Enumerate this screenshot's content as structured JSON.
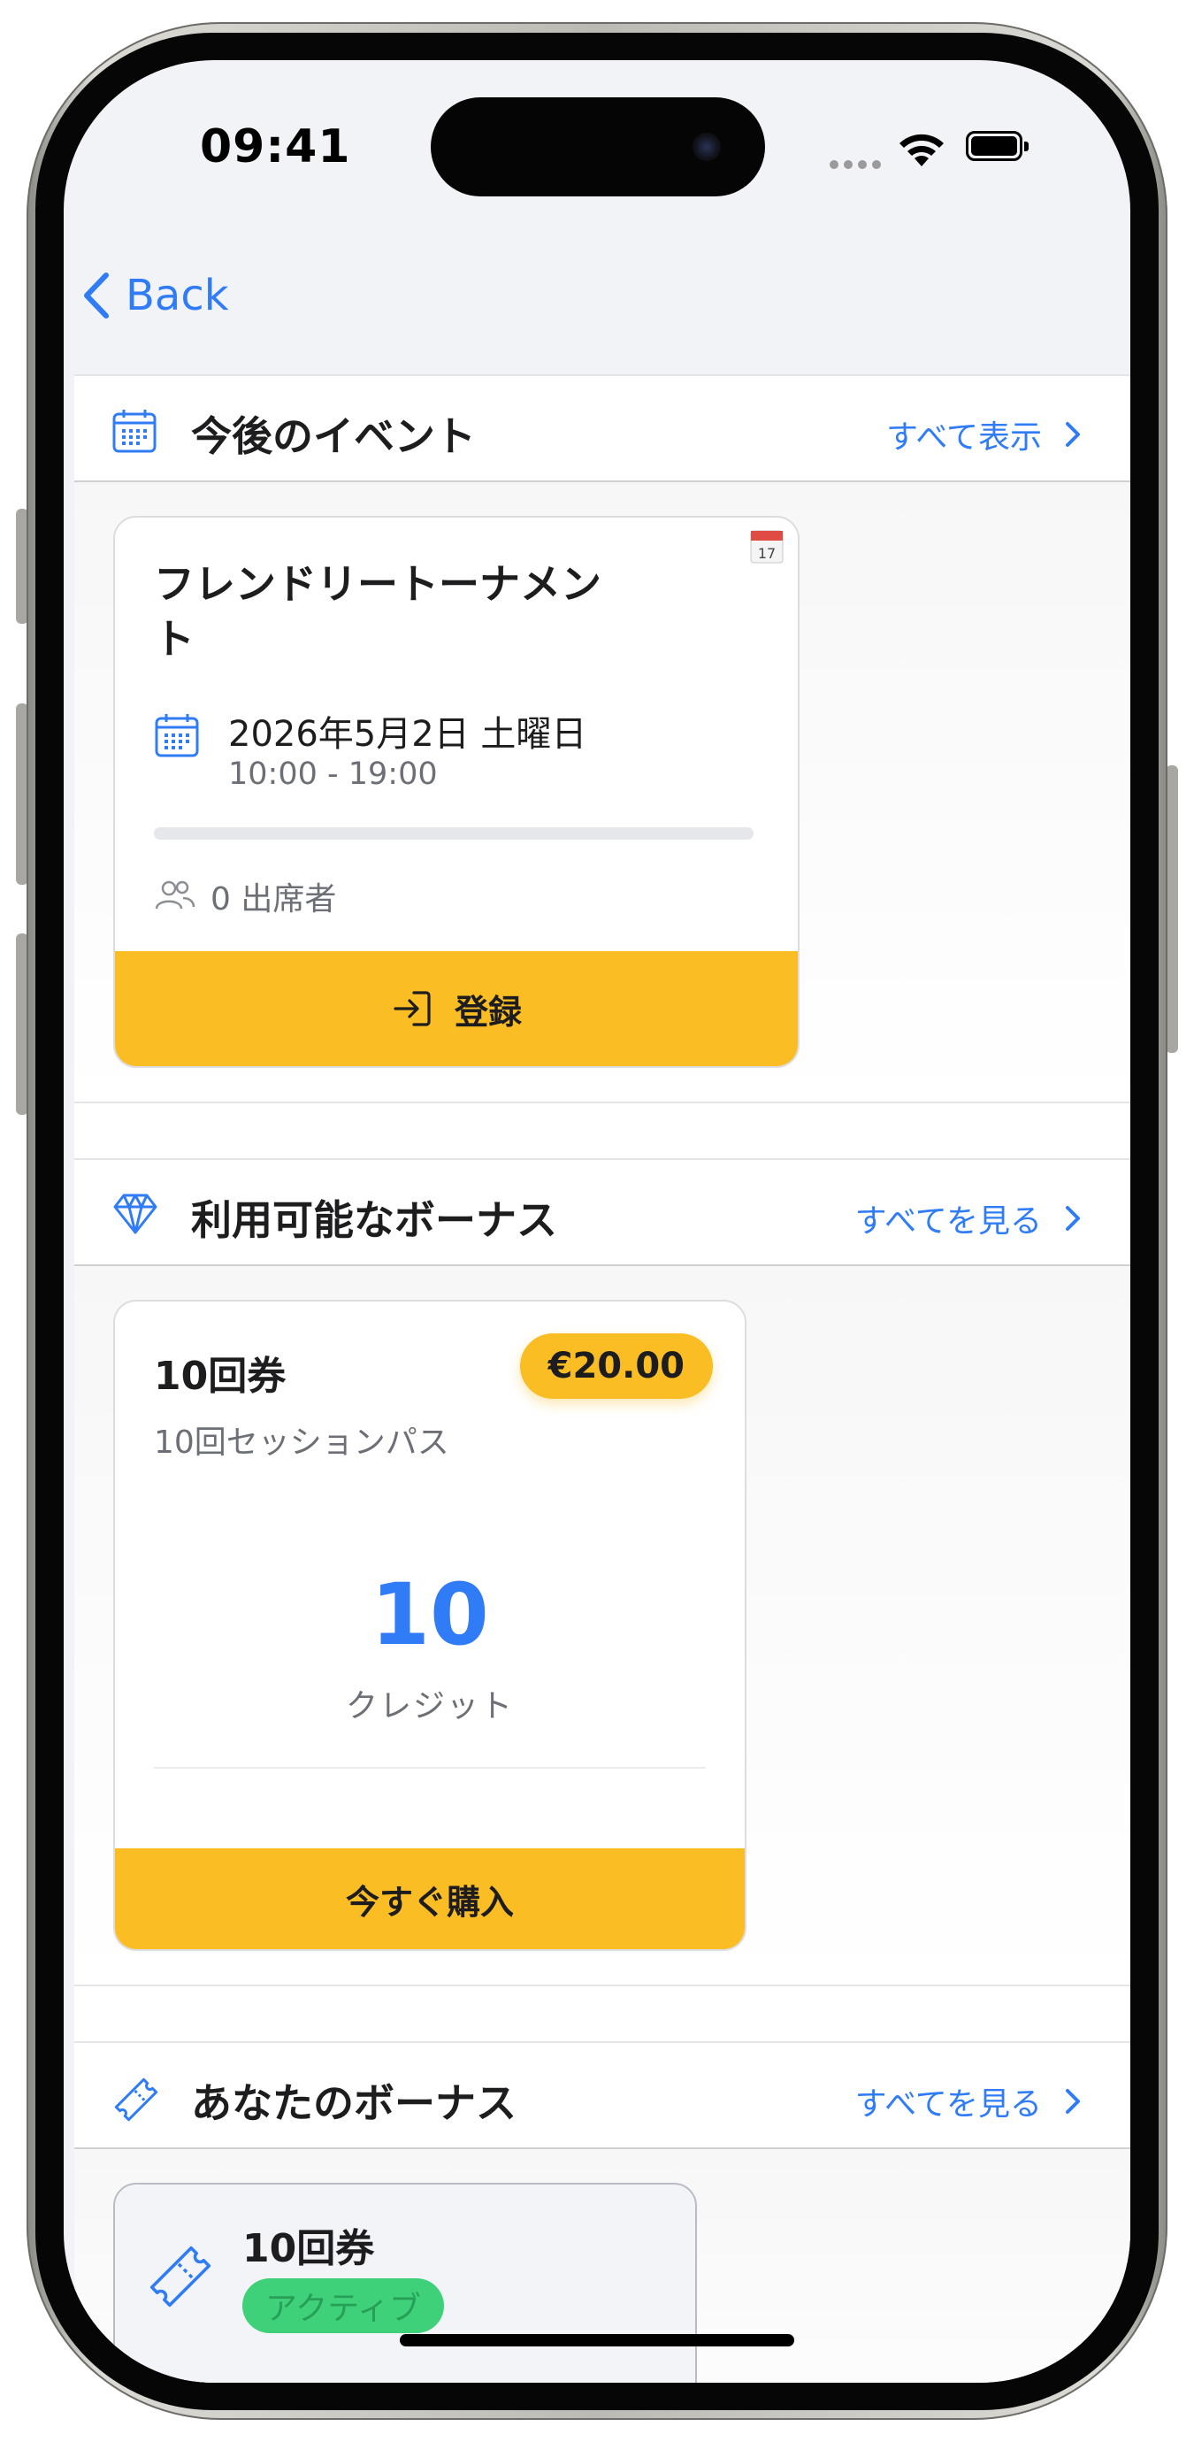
{
  "status_bar": {
    "time": "09:41"
  },
  "nav": {
    "back_label": "Back"
  },
  "upcoming_events": {
    "title": "今後のイベント",
    "see_all": "すべて表示",
    "events": [
      {
        "title": "フレンドリートーナメント",
        "date": "2026年5月2日 土曜日",
        "time": "10:00 - 19:00",
        "calendar_badge_day": "17",
        "attendance_progress": 0,
        "attendees": "0 出席者",
        "register_label": "登録"
      }
    ]
  },
  "available_bonuses": {
    "title": "利用可能なボーナス",
    "see_all": "すべてを見る",
    "items": [
      {
        "name": "10回券",
        "price": "€20.00",
        "description": "10回セッションパス",
        "credits": "10",
        "credits_label": "クレジット",
        "buy_label": "今すぐ購入"
      }
    ]
  },
  "your_bonuses": {
    "title": "あなたのボーナス",
    "see_all": "すべてを見る",
    "items": [
      {
        "name": "10回券",
        "status": "アクティブ"
      }
    ]
  },
  "colors": {
    "accent": "#2f7cf6",
    "cta": "#fabd24",
    "active": "#3fd17a"
  }
}
